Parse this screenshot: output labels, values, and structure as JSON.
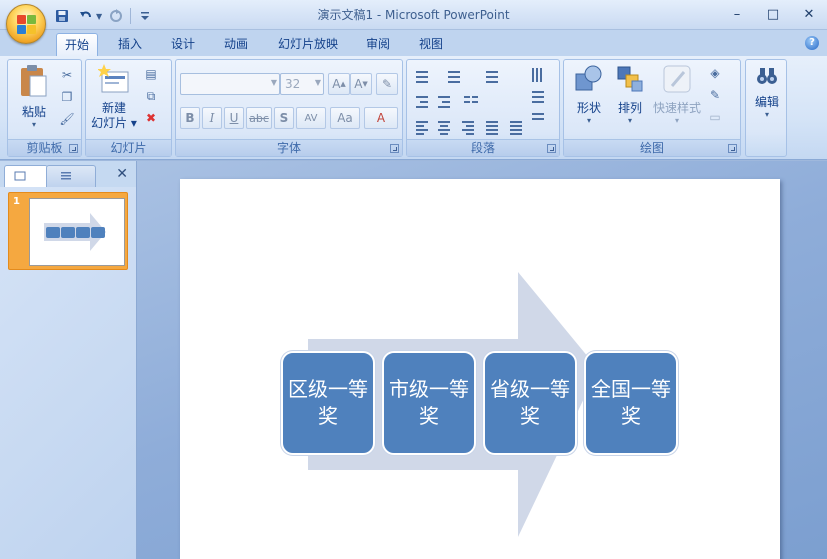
{
  "app": {
    "title": "演示文稿1 - Microsoft PowerPoint",
    "window_controls": [
      "–",
      "□",
      "✕"
    ]
  },
  "quick_access": [
    "save-icon",
    "undo-icon",
    "redo-icon",
    "customize-icon"
  ],
  "tabs": [
    {
      "label": "开始",
      "active": true
    },
    {
      "label": "插入"
    },
    {
      "label": "设计"
    },
    {
      "label": "动画"
    },
    {
      "label": "幻灯片放映"
    },
    {
      "label": "审阅"
    },
    {
      "label": "视图"
    }
  ],
  "ribbon": {
    "clipboard": {
      "label": "剪贴板",
      "paste": "粘贴"
    },
    "slides": {
      "label": "幻灯片",
      "new_slide_line1": "新建",
      "new_slide_line2": "幻灯片"
    },
    "font": {
      "label": "字体",
      "font_name": "",
      "font_size": "32"
    },
    "paragraph": {
      "label": "段落"
    },
    "drawing": {
      "label": "绘图",
      "shapes": "形状",
      "arrange": "排列",
      "quick_styles": "快速样式"
    },
    "editing": {
      "label": "编辑"
    }
  },
  "slide_panel": {
    "thumbnail_number": "1"
  },
  "slide": {
    "boxes": [
      "区级一等奖",
      "市级一等奖",
      "省级一等奖",
      "全国一等奖"
    ],
    "colors": {
      "box": "#4f81bd",
      "arrow": "#d0d8e8"
    }
  }
}
